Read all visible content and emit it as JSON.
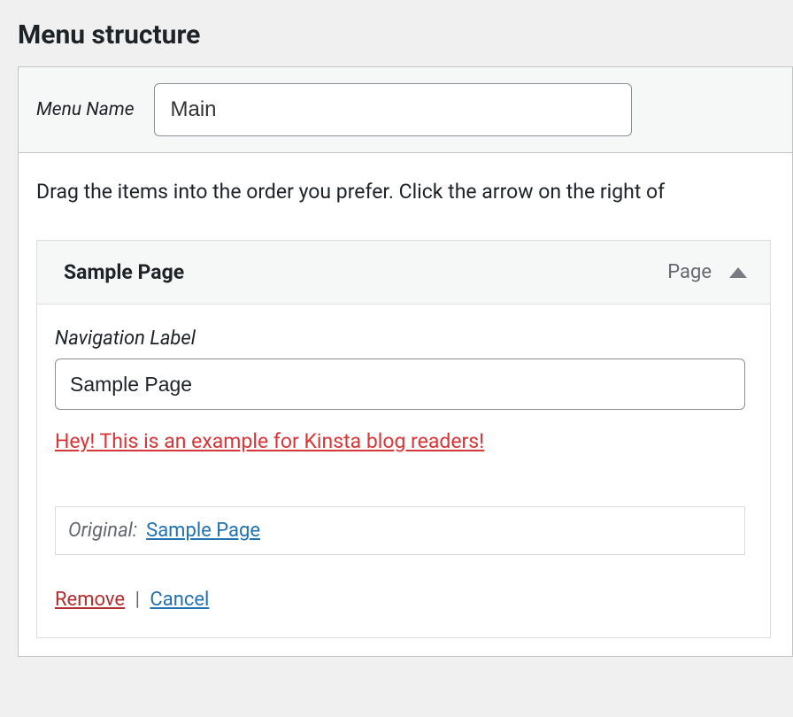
{
  "page_title": "Menu structure",
  "menu_name_label": "Menu Name",
  "menu_name_value": "Main",
  "instructions": "Drag the items into the order you prefer. Click the arrow on the right of",
  "menu_item": {
    "title": "Sample Page",
    "type_label": "Page",
    "nav_label_text": "Navigation Label",
    "nav_label_value": "Sample Page",
    "custom_description": "Hey! This is an example for Kinsta blog readers!",
    "original_label": "Original:",
    "original_link_text": "Sample Page",
    "remove_text": "Remove",
    "separator": "|",
    "cancel_text": "Cancel"
  }
}
